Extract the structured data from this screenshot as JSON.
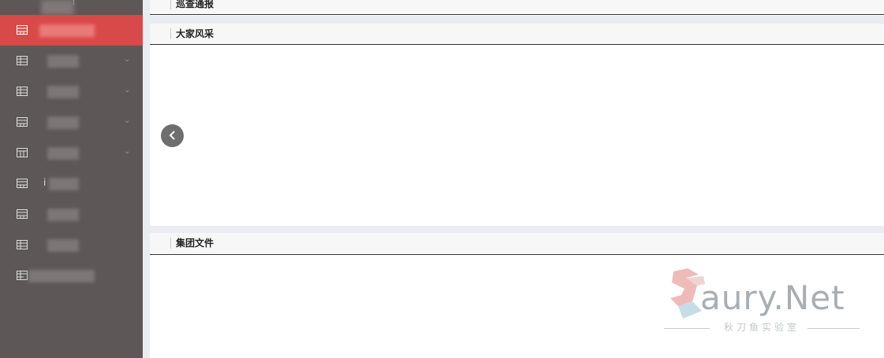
{
  "sidebar": {
    "top_glyph": "⁝",
    "items": [
      {
        "icon": "table-window-icon",
        "active": true,
        "has_chevron": false,
        "glyph": ""
      },
      {
        "icon": "table-grid-icon",
        "active": false,
        "has_chevron": true,
        "glyph": ""
      },
      {
        "icon": "table-grid-icon",
        "active": false,
        "has_chevron": true,
        "glyph": ""
      },
      {
        "icon": "table-window-icon",
        "active": false,
        "has_chevron": true,
        "glyph": ""
      },
      {
        "icon": "table-columns-icon",
        "active": false,
        "has_chevron": true,
        "glyph": ""
      },
      {
        "icon": "table-window-icon",
        "active": false,
        "has_chevron": false,
        "glyph": "i"
      },
      {
        "icon": "table-window-icon",
        "active": false,
        "has_chevron": false,
        "glyph": ""
      },
      {
        "icon": "table-grid-icon",
        "active": false,
        "has_chevron": false,
        "glyph": ""
      },
      {
        "icon": "table-list-icon",
        "active": false,
        "has_chevron": false,
        "glyph": ""
      }
    ],
    "chevron": "⌄"
  },
  "panels": {
    "inspection_report": {
      "title": "巡查通报"
    },
    "everyone_style": {
      "title": "大家风采"
    },
    "group_files": {
      "title": "集团文件"
    }
  },
  "carousel": {
    "prev_icon": "chevron-left-icon"
  },
  "watermark": {
    "brand": "aury.Net",
    "subtitle": "秋刀鱼实验室"
  },
  "colors": {
    "sidebar_bg": "#5d5757",
    "active_item_bg": "#d84a49",
    "main_bg": "#e9ecf1"
  }
}
